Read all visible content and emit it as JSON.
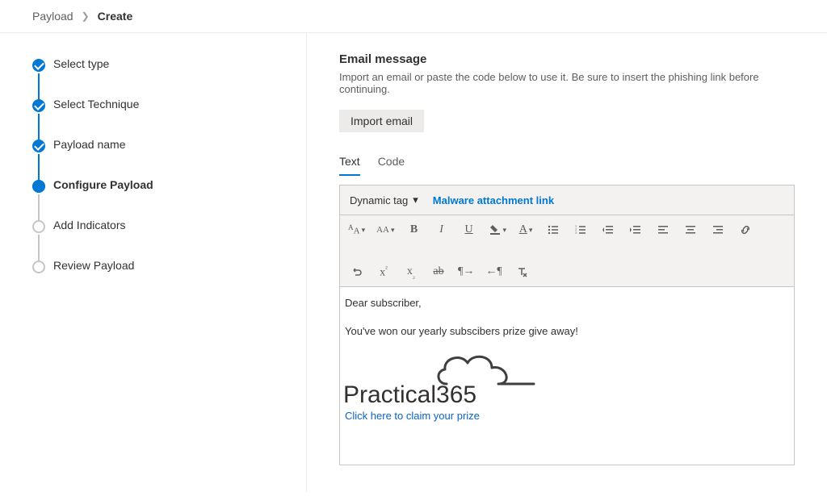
{
  "breadcrumb": {
    "root": "Payload",
    "current": "Create"
  },
  "steps": [
    {
      "label": "Select type",
      "state": "done"
    },
    {
      "label": "Select Technique",
      "state": "done"
    },
    {
      "label": "Payload name",
      "state": "done"
    },
    {
      "label": "Configure Payload",
      "state": "current"
    },
    {
      "label": "Add Indicators",
      "state": "pending"
    },
    {
      "label": "Review Payload",
      "state": "pending"
    }
  ],
  "section": {
    "title": "Email message",
    "subtitle": "Import an email or paste the code below to use it. Be sure to insert the phishing link before continuing.",
    "import_btn": "Import email"
  },
  "tabs": [
    {
      "label": "Text",
      "active": true
    },
    {
      "label": "Code",
      "active": false
    }
  ],
  "editor_bar": {
    "dynamic_tag": "Dynamic tag",
    "attachment_link": "Malware attachment link"
  },
  "email_content": {
    "greeting": "Dear subscriber,",
    "body": "You've won our yearly subscibers prize give away!",
    "logo_text_a": "Practical",
    "logo_text_b": "365",
    "cta": "Click here to claim your prize"
  }
}
